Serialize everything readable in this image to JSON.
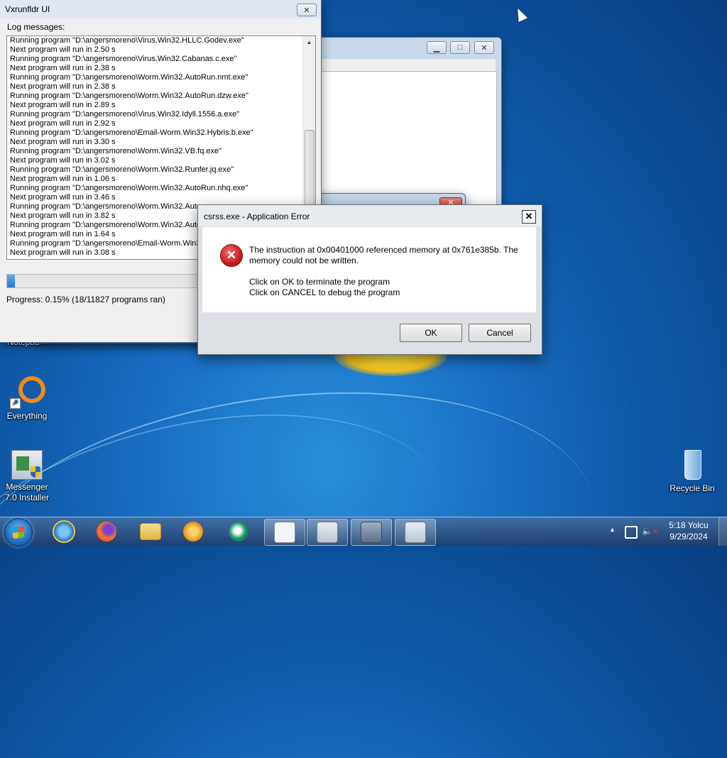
{
  "log_window": {
    "title": "Vxrunfldr UI",
    "close_glyph": "✕",
    "log_label": "Log messages:",
    "log_lines": [
      "Running program \"D:\\angersmoreno\\Virus.Win32.HLLC.Godev.exe\"",
      "Next program will run in 2.50 s",
      "Running program \"D:\\angersmoreno\\Virus.Win32.Cabanas.c.exe\"",
      "Next program will run in 2.38 s",
      "Running program \"D:\\angersmoreno\\Worm.Win32.AutoRun.nmt.exe\"",
      "Next program will run in 2.38 s",
      "Running program \"D:\\angersmoreno\\Worm.Win32.AutoRun.dzw.exe\"",
      "Next program will run in 2.89 s",
      "Running program \"D:\\angersmoreno\\Virus.Win32.Idyll.1556.a.exe\"",
      "Next program will run in 2.92 s",
      "Running program \"D:\\angersmoreno\\Email-Worm.Win32.Hybris.b.exe\"",
      "Next program will run in 3.30 s",
      "Running program \"D:\\angersmoreno\\Worm.Win32.VB.fq.exe\"",
      "Next program will run in 3.02 s",
      "Running program \"D:\\angersmoreno\\Worm.Win32.Runfer.jq.exe\"",
      "Next program will run in 1.06 s",
      "Running program \"D:\\angersmoreno\\Worm.Win32.AutoRun.nhq.exe\"",
      "Next program will run in 3.46 s",
      "Running program \"D:\\angersmoreno\\Worm.Win32.Auto",
      "Next program will run in 3.82 s",
      "Running program \"D:\\angersmoreno\\Worm.Win32.Auto",
      "Next program will run in 1.64 s",
      "Running program \"D:\\angersmoreno\\Email-Worm.Win32",
      "Next program will run in 3.08 s"
    ],
    "progress_fraction": 0.0015,
    "progress_text": "Progress: 0.15% (18/11827 programs ran)"
  },
  "error_dialog": {
    "title": "csrss.exe - Application Error",
    "close_glyph": "✕",
    "message_line1": "The instruction at 0x00401000 referenced memory at 0x761e385b. The memory could not be written.",
    "message_line2": "Click on OK to terminate the program",
    "message_line3": "Click on CANCEL to debug the program",
    "ok_label": "OK",
    "cancel_label": "Cancel"
  },
  "desktop_icons": [
    {
      "label": "Notepad++",
      "icon": "notepad-plus-plus-icon"
    },
    {
      "label": "Everything",
      "icon": "everything-search-icon"
    },
    {
      "label": "Messenger 7.0 Installer",
      "icon": "installer-icon"
    },
    {
      "label": "Recycle Bin",
      "icon": "recycle-bin-icon"
    }
  ],
  "taskbar": {
    "clock_time": "5:18 Yolcu",
    "clock_date": "9/29/2024"
  },
  "colors": {
    "desktop": "#1a6fc4",
    "progress": "#2a78d2",
    "error_icon": "#c81e1e"
  }
}
